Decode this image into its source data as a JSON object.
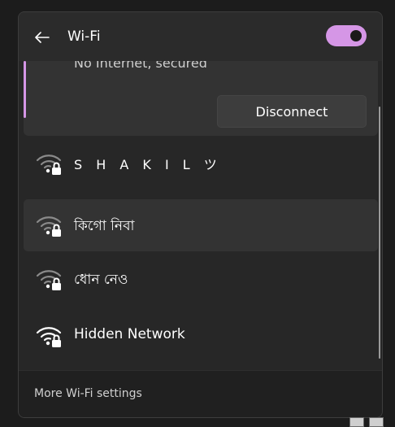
{
  "header": {
    "title": "Wi-Fi",
    "back_icon": "arrow-left-icon",
    "toggle_state": "on"
  },
  "connected": {
    "status": "No Internet, secured",
    "disconnect_label": "Disconnect"
  },
  "networks": [
    {
      "name": "S H A K I L ツ",
      "icon": "wifi-secured-weak-icon"
    },
    {
      "name": "কিগো নিবা",
      "icon": "wifi-secured-weak-icon"
    },
    {
      "name": "ধোন নেও",
      "icon": "wifi-secured-weak-icon"
    },
    {
      "name": "Hidden Network",
      "icon": "wifi-secured-full-icon"
    }
  ],
  "footer": {
    "settings_link": "More Wi-Fi settings"
  },
  "colors": {
    "accent": "#d596e6",
    "panel": "#2b2b2b"
  }
}
